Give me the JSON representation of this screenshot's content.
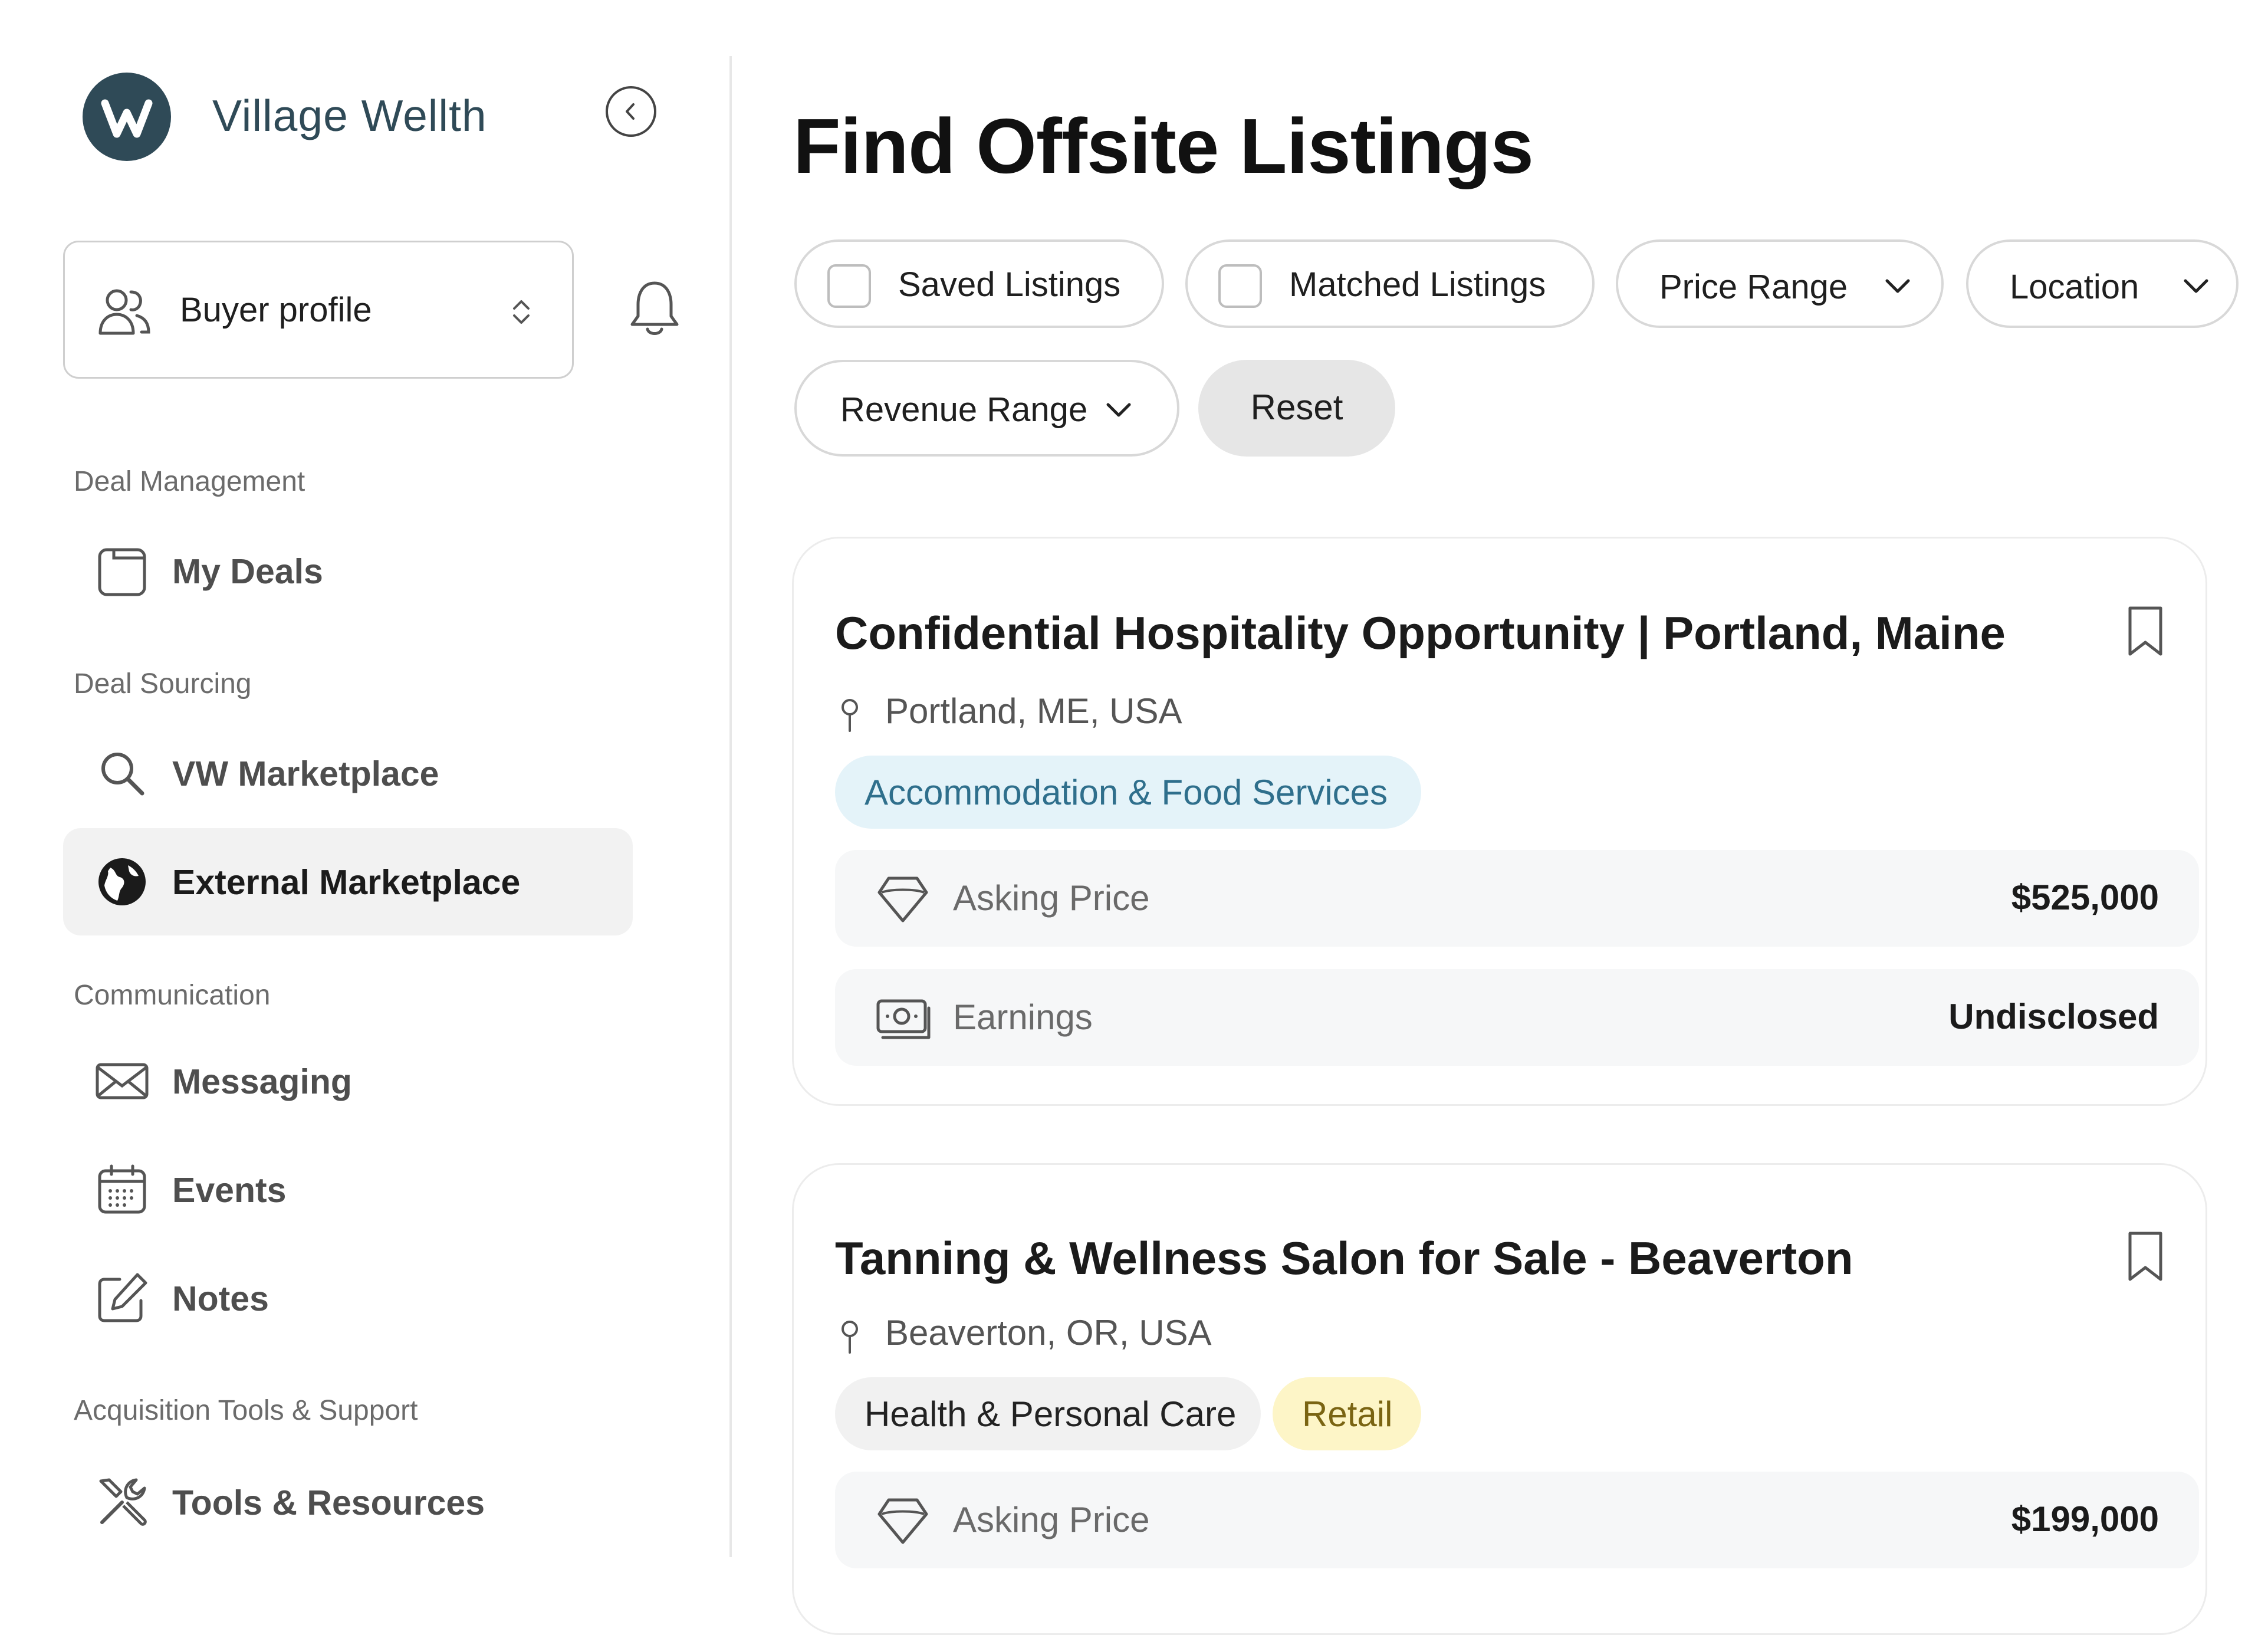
{
  "app": {
    "brand": "Village Wellth",
    "brand_mark": "VW",
    "accent_color": "#2f4a57"
  },
  "sidebar": {
    "profile_selector": {
      "label": "Buyer profile",
      "icon": "users-icon"
    },
    "sections": [
      {
        "label": "Deal Management",
        "items": [
          {
            "label": "My Deals",
            "icon": "folder-icon"
          }
        ]
      },
      {
        "label": "Deal Sourcing",
        "items": [
          {
            "label": "VW Marketplace",
            "icon": "search-icon"
          },
          {
            "label": "External Marketplace",
            "icon": "globe-icon",
            "active": true
          }
        ]
      },
      {
        "label": "Communication",
        "items": [
          {
            "label": "Messaging",
            "icon": "envelope-icon"
          },
          {
            "label": "Events",
            "icon": "calendar-icon"
          },
          {
            "label": "Notes",
            "icon": "pencil-square-icon"
          }
        ]
      },
      {
        "label": "Acquisition Tools & Support",
        "items": [
          {
            "label": "Tools & Resources",
            "icon": "tools-icon"
          }
        ]
      }
    ]
  },
  "main": {
    "title": "Find Offsite Listings",
    "filters": {
      "saved_label": "Saved Listings",
      "matched_label": "Matched Listings",
      "price_label": "Price Range",
      "location_label": "Location",
      "revenue_label": "Revenue Range",
      "reset_label": "Reset"
    },
    "listings": [
      {
        "title": "Confidential Hospitality Opportunity | Portland, Maine",
        "location": "Portland, ME, USA",
        "tags": [
          {
            "label": "Accommodation & Food Services",
            "color": "#e4f3f9"
          }
        ],
        "metrics": [
          {
            "label": "Asking Price",
            "value": "$525,000",
            "icon": "diamond-icon"
          },
          {
            "label": "Earnings",
            "value": "Undisclosed",
            "icon": "money-icon"
          }
        ]
      },
      {
        "title": "Tanning & Wellness Salon for Sale - Beaverton",
        "location": "Beaverton, OR, USA",
        "tags": [
          {
            "label": "Health & Personal Care",
            "color": "#f1f1f1"
          },
          {
            "label": "Retail",
            "color": "#fdf5c7"
          }
        ],
        "metrics": [
          {
            "label": "Asking Price",
            "value": "$199,000",
            "icon": "diamond-icon"
          }
        ]
      }
    ]
  }
}
